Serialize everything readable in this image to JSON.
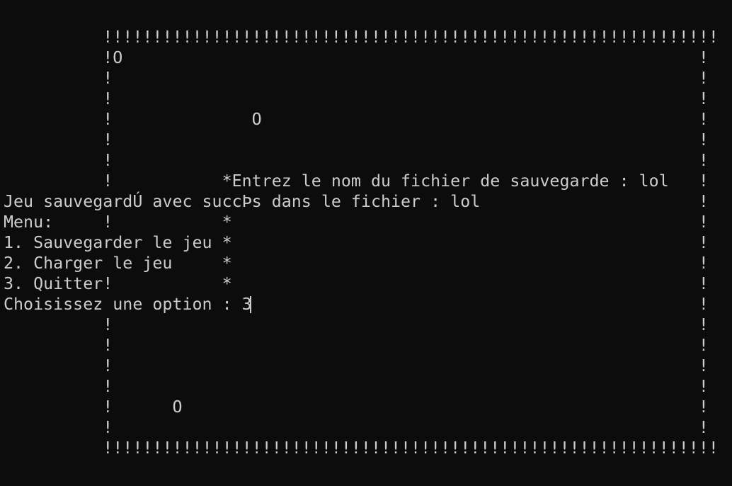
{
  "terminal": {
    "lines": [
      "          !!!!!!!!!!!!!!!!!!!!!!!!!!!!!!!!!!!!!!!!!!!!!!!!!!!!!!!!!!!!!!",
      "          !O                                                          !",
      "          !                                                           !",
      "          !                                                           !",
      "          !              O                                            !",
      "          !                                                           !",
      "          !                                                           !",
      "          !           *Entrez le nom du fichier de sauvegarde : lol   !",
      "Jeu sauvegardÚ avec succÞs dans le fichier : lol                      !",
      "Menu:     !           *                                               !",
      "1. Sauvegarder le jeu *                                               !",
      "2. Charger le jeu     *                                               !",
      "3. Quitter!           *                                               !",
      "Choisissez une option : 3                                             !",
      "          !                                                           !",
      "          !                                                           !",
      "          !                                                           !",
      "          !                                                           !",
      "          !      O                                                    !",
      "          !                                                           !",
      "          !!!!!!!!!!!!!!!!!!!!!!!!!!!!!!!!!!!!!!!!!!!!!!!!!!!!!!!!!!!!!!"
    ]
  }
}
